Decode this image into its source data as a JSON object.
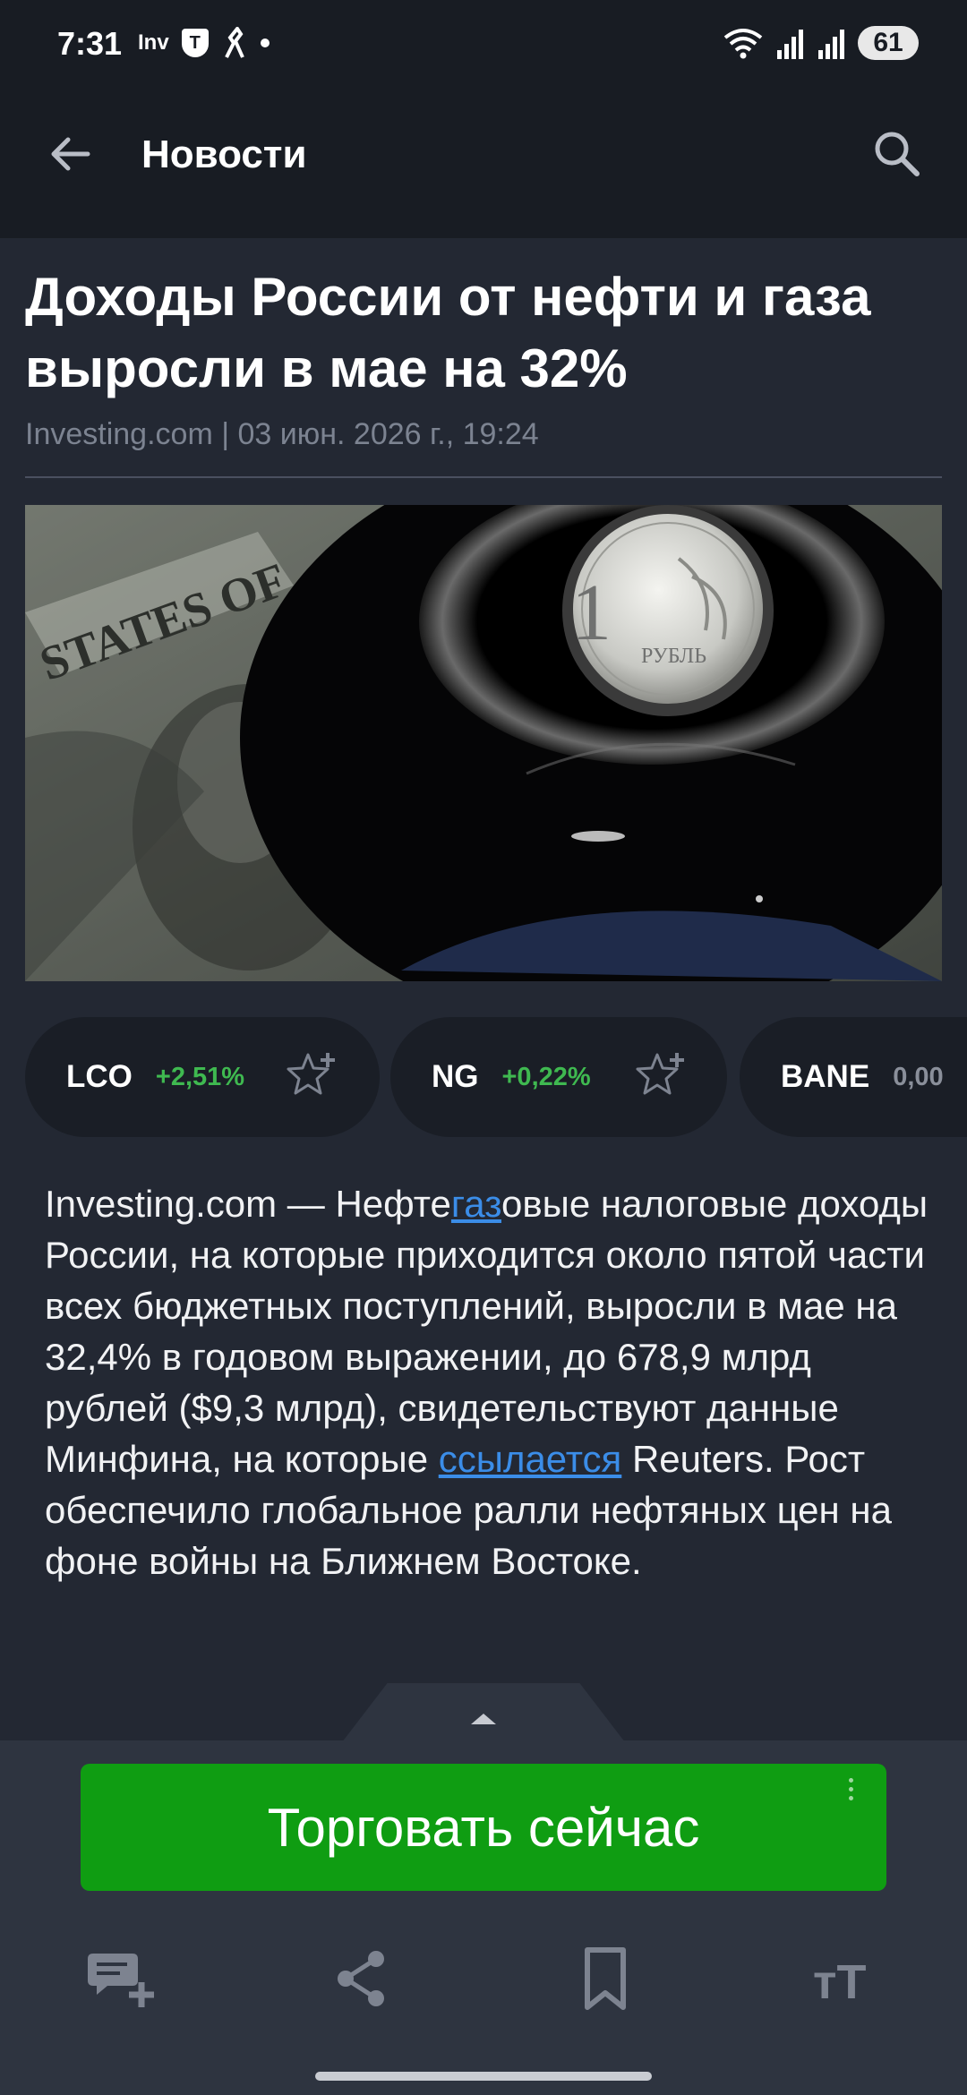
{
  "status_bar": {
    "time": "7:31",
    "left_icons": [
      "investing-notification-icon",
      "vpn-shield-icon",
      "navigation-icon",
      "more-notifications-dot"
    ],
    "inv_label": "Inv",
    "shield_label": "T",
    "battery": "61"
  },
  "app_bar": {
    "title": "Новости",
    "back_icon": "arrow-back-icon",
    "search_icon": "search-icon"
  },
  "article": {
    "title": "Доходы России от нефти и газа выросли в мае на 32%",
    "source_line": "Investing.com | 03 июн. 2026 г., 19:24",
    "image": {
      "subject": "photo",
      "coin_numeral": "1",
      "coin_text": "РУБЛЬ",
      "bill_text": "STATES OF"
    },
    "body": {
      "part1": "Investing.com — Нефте",
      "link1": "газ",
      "part2": "овые налоговые доходы России, на которые приходится около пятой части всех бюджетных поступлений, выросли в мае на 32,4% в годовом выражении, до 678,9 млрд рублей ($9,3 млрд), свидетельствуют данные Минфина, на которые ",
      "link2": "ссылается",
      "part3": " Reuters. Рост обеспечило глобальное ралли нефтяных цен на фоне войны на Ближнем Востоке."
    }
  },
  "instruments": [
    {
      "symbol": "LCO",
      "change": "+2,51%",
      "direction": "up"
    },
    {
      "symbol": "NG",
      "change": "+0,22%",
      "direction": "up"
    },
    {
      "symbol": "BANE",
      "change": "0,00",
      "direction": "flat"
    }
  ],
  "cta": {
    "label": "Торговать сейчас",
    "color": "#0f9d12"
  },
  "bottom_toolbar": [
    {
      "name": "add-comment-icon"
    },
    {
      "name": "share-icon"
    },
    {
      "name": "bookmark-icon"
    },
    {
      "name": "text-size-icon",
      "glyph": "тТ"
    }
  ],
  "colors": {
    "background": "#232833",
    "bar": "#181c23",
    "positive": "#3fb950",
    "link": "#3b8de8"
  }
}
